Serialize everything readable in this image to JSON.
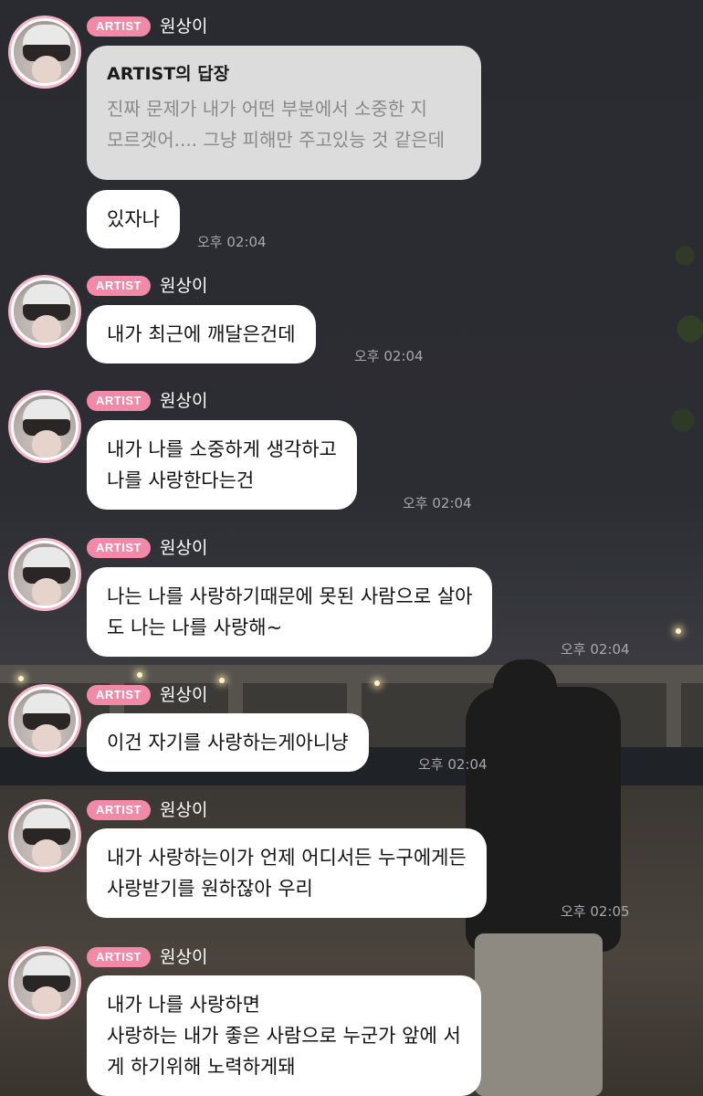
{
  "colors": {
    "badge": "#f28aa7",
    "bubble": "#ffffff",
    "reply_bubble": "#dcdcdc",
    "time_text": "#a8a8ac"
  },
  "reply": {
    "title": "ARTIST의 답장",
    "lines": [
      "진짜 문제가 내가 어떤 부분에서 소중한 지",
      "모르겟어.... 그냥 피해만 주고있능 것 같은데"
    ]
  },
  "messages": [
    {
      "badge": "ARTIST",
      "sender": "원상이",
      "avatar": "profile-avatar",
      "lines": [
        "있자나"
      ],
      "time": "오후 02:04"
    },
    {
      "badge": "ARTIST",
      "sender": "원상이",
      "avatar": "profile-avatar",
      "lines": [
        "내가 최근에 깨달은건데"
      ],
      "time": "오후 02:04"
    },
    {
      "badge": "ARTIST",
      "sender": "원상이",
      "avatar": "profile-avatar",
      "lines": [
        "내가 나를 소중하게 생각하고",
        "나를 사랑한다는건"
      ],
      "time": "오후 02:04"
    },
    {
      "badge": "ARTIST",
      "sender": "원상이",
      "avatar": "profile-avatar",
      "lines": [
        "나는 나를 사랑하기때문에 못된 사람으로 살아",
        "도 나는 나를 사랑해~"
      ],
      "time": "오후 02:04"
    },
    {
      "badge": "ARTIST",
      "sender": "원상이",
      "avatar": "profile-avatar",
      "lines": [
        "이건 자기를 사랑하는게아니냥"
      ],
      "time": "오후 02:04"
    },
    {
      "badge": "ARTIST",
      "sender": "원상이",
      "avatar": "profile-avatar",
      "lines": [
        "내가 사랑하는이가 언제 어디서든 누구에게든",
        "사랑받기를 원하잖아 우리"
      ],
      "time": "오후 02:05"
    },
    {
      "badge": "ARTIST",
      "sender": "원상이",
      "avatar": "profile-avatar",
      "lines": [
        "내가 나를 사랑하면",
        "사랑하는 내가 좋은 사람으로 누군가 앞에 서",
        "게 하기위해 노력하게돼"
      ]
    }
  ]
}
